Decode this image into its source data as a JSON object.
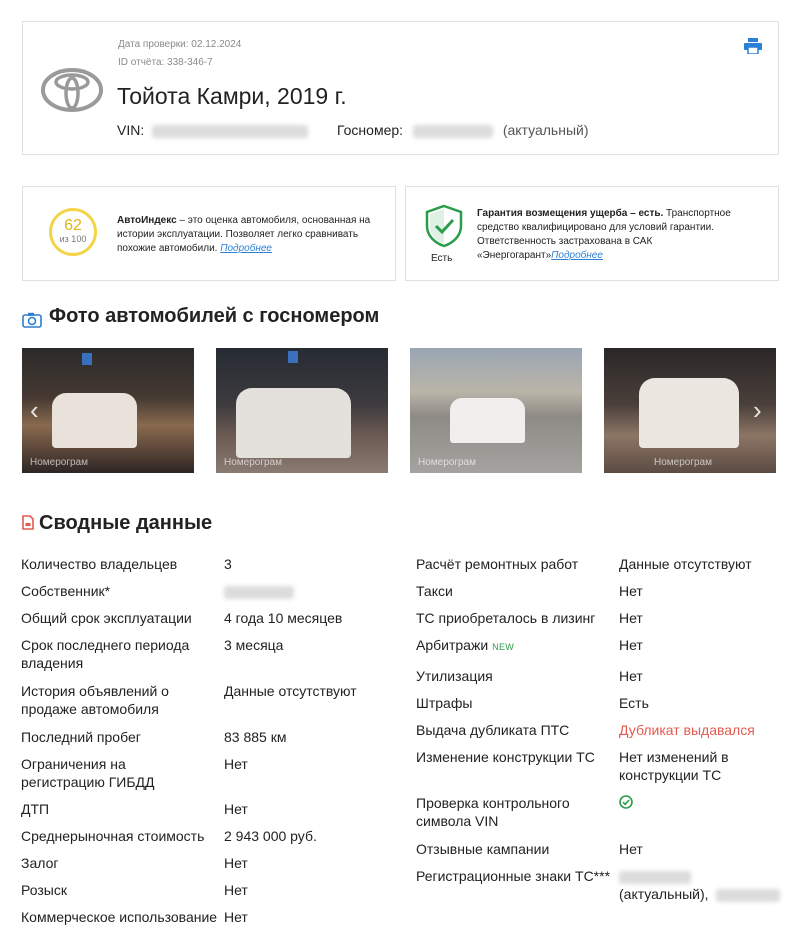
{
  "header": {
    "check_date": "Дата проверки: 02.12.2024",
    "report_id": "ID отчёта: 338-346-7",
    "title": "Тойота Камри, 2019 г.",
    "vin_label": "VIN:",
    "plate_label": "Госномер:",
    "plate_status": "(актуальный)",
    "logo_icon": "toyota-logo",
    "print_icon": "printer-icon"
  },
  "autoindex": {
    "score": "62",
    "score_sub": "из 100",
    "title": "АвтоИндекс",
    "text": " – это оценка автомобиля, основанная на истории эксплуатации. Позволяет легко сравнивать похожие автомобили. ",
    "link": "Подробнее"
  },
  "guarantee": {
    "badge_label": "Есть",
    "title": "Гарантия возмещения ущерба – есть.",
    "text": " Транспортное средство квалифицировано для условий гарантии. Ответственность застрахована в САК «Энергогарант»",
    "link": "Подробнее"
  },
  "photos": {
    "title": "Фото автомобилей с госномером",
    "watermark": "Номерограм",
    "icon": "camera-icon",
    "arrow_left": "‹",
    "arrow_right": "›"
  },
  "summary": {
    "title": "Сводные данные",
    "icon": "document-icon",
    "left": [
      {
        "label": "Количество владельцев",
        "value": "3"
      },
      {
        "label": "Собственник*",
        "value": ""
      },
      {
        "label": "Общий срок эксплуатации",
        "value": "4 года 10 месяцев"
      },
      {
        "label": "Срок последнего периода владения",
        "value": "3 месяца"
      },
      {
        "label": "История объявлений о продаже автомобиля",
        "value": "Данные отсутствуют"
      },
      {
        "label": "Последний пробег",
        "value": "83 885 км"
      },
      {
        "label": "Ограничения на регистрацию ГИБДД",
        "value": "Нет"
      },
      {
        "label": "ДТП",
        "value": "Нет"
      },
      {
        "label": "Среднерыночная стоимость",
        "value": "2 943 000 руб."
      },
      {
        "label": "Залог",
        "value": "Нет"
      },
      {
        "label": "Розыск",
        "value": "Нет"
      },
      {
        "label": "Коммерческое использование",
        "value": "Нет"
      }
    ],
    "right": [
      {
        "label": "Расчёт ремонтных работ",
        "value": "Данные отсутствуют"
      },
      {
        "label": "Такси",
        "value": "Нет"
      },
      {
        "label": "ТС приобреталось в лизинг",
        "value": "Нет"
      },
      {
        "label": "Арбитражи",
        "badge": "NEW",
        "value": "Нет"
      },
      {
        "label": "Утилизация",
        "value": "Нет"
      },
      {
        "label": "Штрафы",
        "value": "Есть"
      },
      {
        "label": "Выдача дубликата ПТС",
        "value": "Дубликат выдавался"
      },
      {
        "label": "Изменение конструкции ТС",
        "value": "Нет изменений в конструкции ТС"
      },
      {
        "label": "Проверка контрольного символа VIN",
        "value": ""
      },
      {
        "label": "Отзывные кампании",
        "value": "Нет"
      },
      {
        "label": "Регистрационные знаки ТС***",
        "value": "(актуальный),"
      }
    ]
  }
}
